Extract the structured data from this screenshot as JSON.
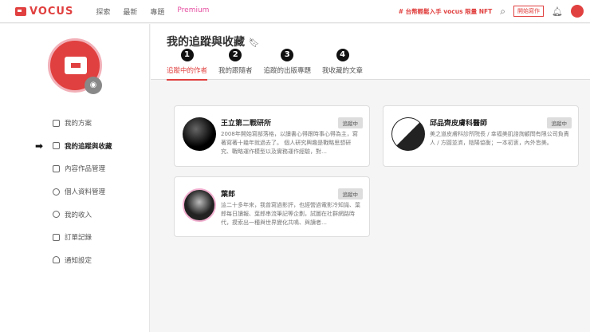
{
  "header": {
    "logo": "VOCUS",
    "nav": [
      "探索",
      "最新",
      "專題",
      "Premium"
    ],
    "promo": "# 台幣輕鬆入手 vocus 限量 NFT",
    "write_button": "開始寫作"
  },
  "sidebar": {
    "items": [
      "我的方案",
      "我的追蹤與收藏",
      "內容作品管理",
      "個人資料管理",
      "我的收入",
      "訂單記錄",
      "通知設定"
    ],
    "active": 1
  },
  "main": {
    "title": "我的追蹤與收藏",
    "tabs": [
      {
        "label": "追蹤中的作者",
        "num": "1"
      },
      {
        "label": "我的跟隨者",
        "num": "2"
      },
      {
        "label": "追蹤的出版專題",
        "num": "3"
      },
      {
        "label": "我收藏的文章",
        "num": "4"
      }
    ],
    "cards": [
      {
        "name": "王立第二戰研所",
        "badge": "追蹤中",
        "desc": "2008年開始寫部落格，以讀書心得跟時事心得為主，寫著寫著十幾年就過去了。 個人研究興趣是戰略思想研究、戰略運作模型以及實務運作經驗，對…"
      },
      {
        "name": "邱品齊皮膚科醫師",
        "badge": "追蹤中",
        "desc": "美之道皮膚科診所院長 / 幸福美肌諮詢顧問有限公司負責人 / 方圓並濟，陰陽協衡；一本初衷，內外皆美。"
      },
      {
        "name": "葉郎",
        "badge": "追蹤中",
        "desc": "這二十多年來，我曾寫過影評，也經營過電影冷知識、葉郎每日讀報、葉郎串流筆記等企劃，試圖在社群網路時代，摸索出一種與世界變化共鳴、與讀者…"
      }
    ]
  }
}
